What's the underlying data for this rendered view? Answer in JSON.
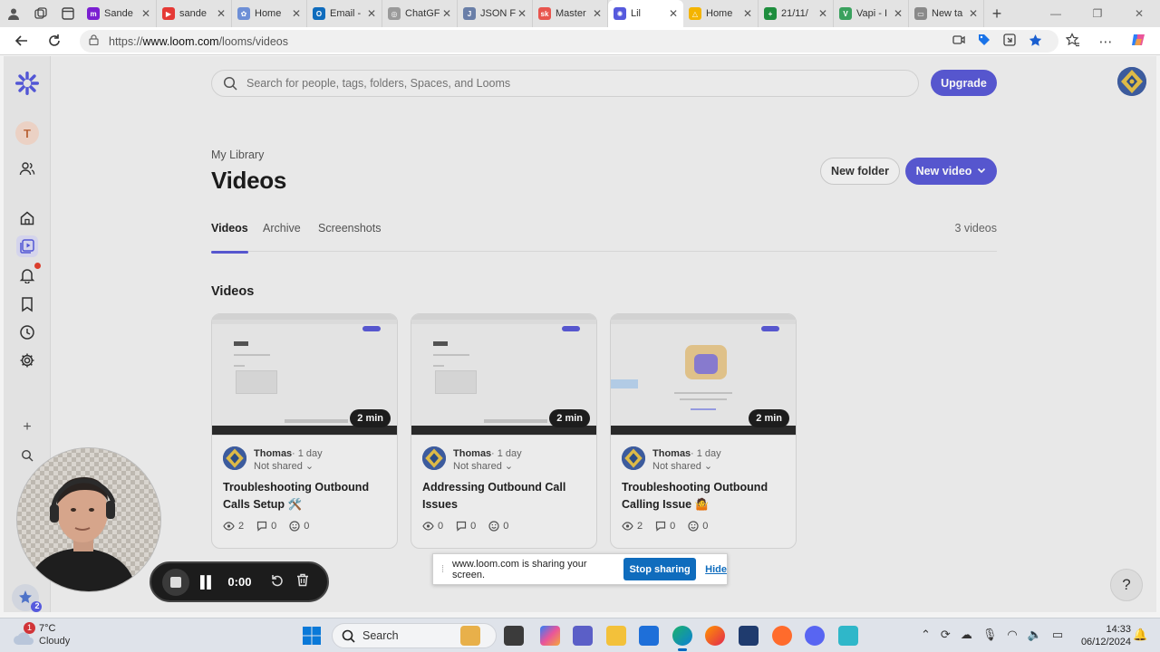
{
  "browser": {
    "tabs": [
      {
        "title": "Sande",
        "favicon_color": "#7b1fd1",
        "favicon_glyph": "m"
      },
      {
        "title": "sande",
        "favicon_color": "#e53935",
        "favicon_glyph": "▶"
      },
      {
        "title": "Home",
        "favicon_color": "#6e8fd6",
        "favicon_glyph": "✿"
      },
      {
        "title": "Email -",
        "favicon_color": "#0f6cbd",
        "favicon_glyph": "O"
      },
      {
        "title": "ChatGF",
        "favicon_color": "#9a9a9a",
        "favicon_glyph": "◎"
      },
      {
        "title": "JSON F",
        "favicon_color": "#6a7fa8",
        "favicon_glyph": "J"
      },
      {
        "title": "Master",
        "favicon_color": "#e8554e",
        "favicon_glyph": "sk"
      },
      {
        "title": "Lil",
        "favicon_color": "#565ADD",
        "favicon_glyph": "✺",
        "active": true
      },
      {
        "title": "Home",
        "favicon_color": "#f4b400",
        "favicon_glyph": "△"
      },
      {
        "title": "21/11/",
        "favicon_color": "#1e8e3e",
        "favicon_glyph": "+"
      },
      {
        "title": "Vapi - I",
        "favicon_color": "#3aa15e",
        "favicon_glyph": "V"
      },
      {
        "title": "New ta",
        "favicon_color": "#8a8a8a",
        "favicon_glyph": "▭"
      }
    ],
    "url_prefix": "https://",
    "url_domain": "www.loom.com",
    "url_path": "/looms/videos"
  },
  "app": {
    "accent": "#5a5ad6",
    "search_placeholder": "Search for people, tags, folders, Spaces, and Looms",
    "upgrade_label": "Upgrade",
    "workspace_initial": "T",
    "breadcrumb": "My Library",
    "page_title": "Videos",
    "new_folder_label": "New folder",
    "new_video_label": "New video",
    "tabs": [
      {
        "label": "Videos",
        "active": true
      },
      {
        "label": "Archive"
      },
      {
        "label": "Screenshots"
      }
    ],
    "video_count": "3 videos",
    "section_title": "Videos",
    "help_label": "?"
  },
  "videos": [
    {
      "duration": "2 min",
      "author": "Thomas",
      "ago": "· 1 day",
      "sharing": "Not shared",
      "title": "Troubleshooting Outbound Calls Setup 🛠️",
      "views": "2",
      "comments": "0",
      "reactions": "0",
      "variant": "library"
    },
    {
      "duration": "2 min",
      "author": "Thomas",
      "ago": "· 1 day",
      "sharing": "Not shared",
      "title": "Addressing Outbound Call Issues",
      "views": "0",
      "comments": "0",
      "reactions": "0",
      "variant": "library"
    },
    {
      "duration": "2 min",
      "author": "Thomas",
      "ago": "· 1 day",
      "sharing": "Not shared",
      "title": "Troubleshooting Outbound Calling Issue 🤷",
      "views": "2",
      "comments": "0",
      "reactions": "0",
      "variant": "illustration"
    }
  ],
  "share_banner": {
    "message": "www.loom.com is sharing your screen.",
    "stop_label": "Stop sharing",
    "hide_label": "Hide"
  },
  "recorder": {
    "time": "0:00",
    "badge_count": "2"
  },
  "taskbar": {
    "temperature": "7°C",
    "condition": "Cloudy",
    "weather_badge": "1",
    "search_label": "Search",
    "time": "14:33",
    "date": "06/12/2024"
  }
}
